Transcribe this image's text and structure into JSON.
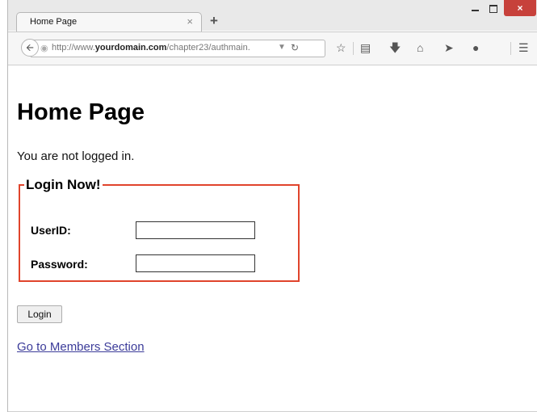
{
  "browser": {
    "tab": {
      "title": "Home Page",
      "close_glyph": "×"
    },
    "new_tab_glyph": "+",
    "window_controls": {
      "minimize": "minimize-icon",
      "maximize": "maximize-icon",
      "close_glyph": "×"
    },
    "url": {
      "prefix": "http://www.",
      "domain": "yourdomain.com",
      "path": "/chapter23/authmain."
    },
    "toolbar_icons": [
      "back-icon",
      "site-identity-icon",
      "dropdown-icon",
      "reload-icon",
      "bookmark-star-icon",
      "reading-list-icon",
      "download-icon",
      "home-icon",
      "share-icon",
      "chat-icon",
      "menu-icon"
    ]
  },
  "page": {
    "heading": "Home Page",
    "status_text": "You are not logged in.",
    "login_form": {
      "legend": "Login Now!",
      "userid_label": "UserID:",
      "userid_value": "",
      "password_label": "Password:",
      "password_value": ""
    },
    "login_button": "Login",
    "members_link": "Go to Members Section"
  },
  "colors": {
    "fieldset_border": "#e0442c",
    "link": "#3b3b99",
    "close_button": "#c7413b"
  }
}
